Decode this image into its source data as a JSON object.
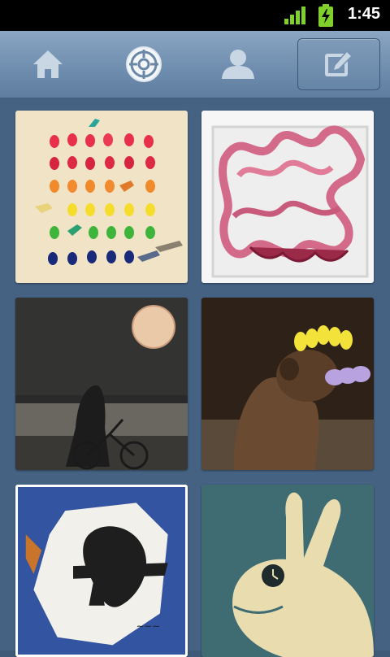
{
  "status_bar": {
    "time": "1:45",
    "signal_icon": "signal-bars-icon",
    "battery_icon": "battery-charging-icon",
    "accent": "#7fd02b"
  },
  "tabs": [
    {
      "name": "home",
      "icon": "home-icon",
      "selected": false
    },
    {
      "name": "explore",
      "icon": "explore-target-icon",
      "selected": true
    },
    {
      "name": "profile",
      "icon": "person-icon",
      "selected": false
    }
  ],
  "compose": {
    "icon": "compose-edit-icon"
  },
  "photos": [
    {
      "subject": "jelly-beans-grid-photo"
    },
    {
      "subject": "pink-glass-vase-photo"
    },
    {
      "subject": "moon-bicycle-night-photo"
    },
    {
      "subject": "dog-with-peeps-photo"
    },
    {
      "subject": "giraffe-graffiti-photo"
    },
    {
      "subject": "rabbit-clock-illustration-photo"
    }
  ],
  "colors": {
    "tabbar": "#7392b2",
    "background": "#456283"
  }
}
